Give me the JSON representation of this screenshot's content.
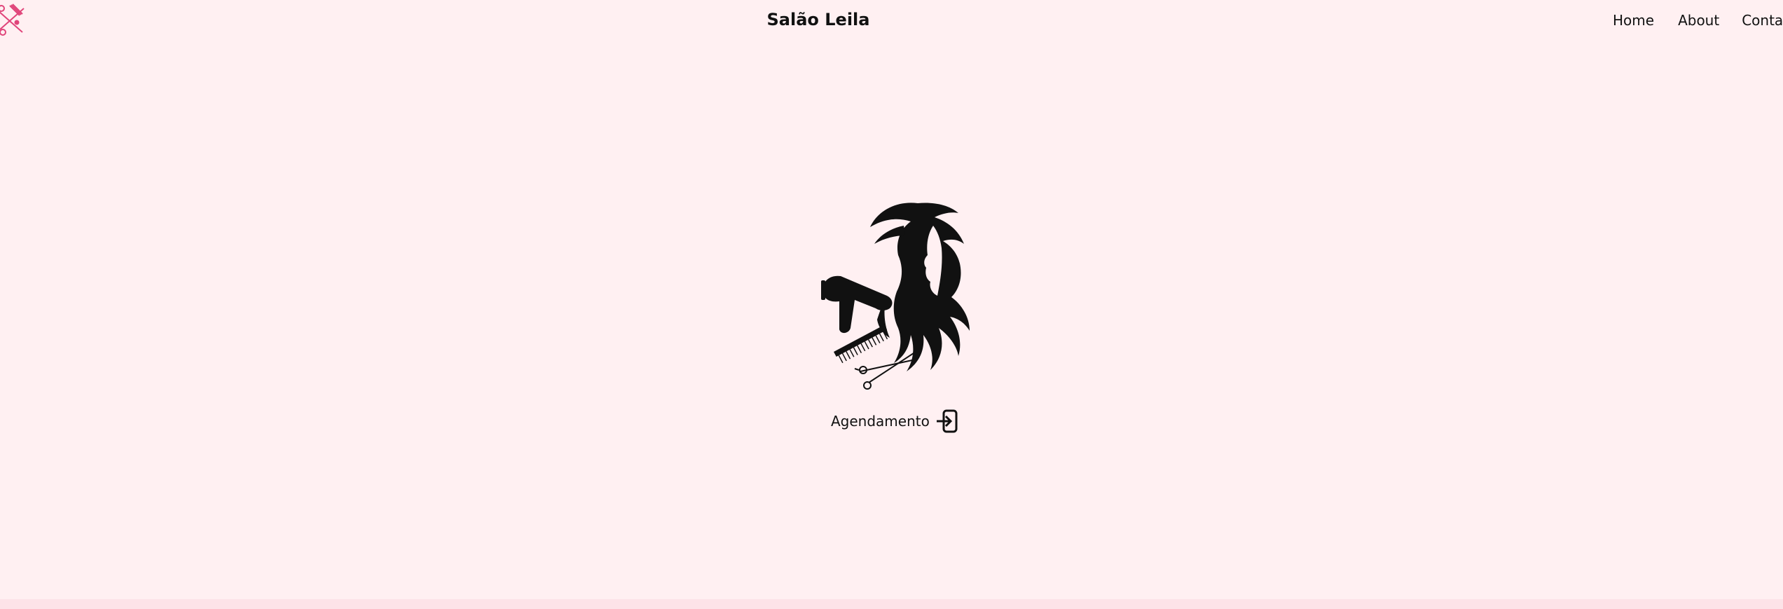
{
  "header": {
    "title": "Salão Leila",
    "logo_icon": "scissors-comb-icon",
    "nav": [
      {
        "label": "Home"
      },
      {
        "label": "About"
      },
      {
        "label": "Contato"
      }
    ]
  },
  "hero": {
    "illustration": "woman-hair-salon-icon",
    "cta_label": "Agendamento",
    "cta_icon": "login-arrow-icon"
  },
  "colors": {
    "background": "#fff0f2",
    "accent": "#e0457a",
    "text": "#111111"
  }
}
